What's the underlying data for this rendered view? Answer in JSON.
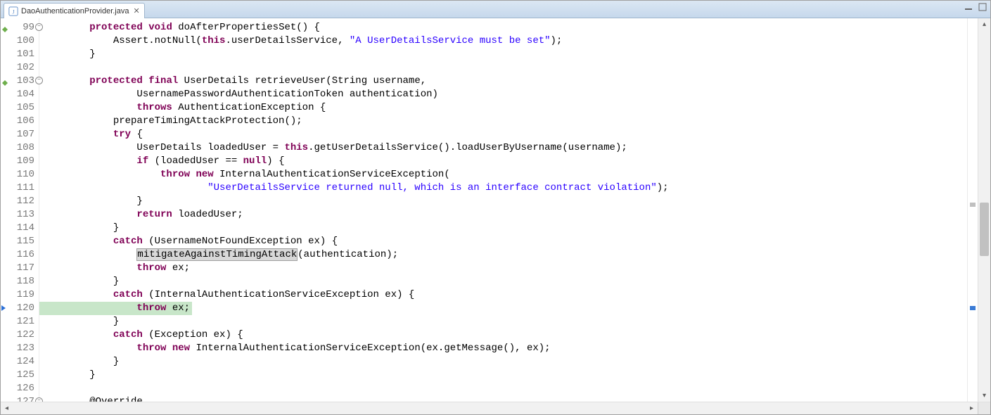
{
  "tab": {
    "filename": "DaoAuthenticationProvider.java",
    "close_glyph": "✕"
  },
  "gutter": {
    "start": 99,
    "end": 127,
    "fold_lines": [
      99,
      103,
      127
    ],
    "instruction_pointer": 120
  },
  "code": {
    "lines": [
      {
        "n": 99,
        "indent": 2,
        "tokens": [
          [
            "kw",
            "protected"
          ],
          [
            "txt",
            " "
          ],
          [
            "kw",
            "void"
          ],
          [
            "txt",
            " doAfterPropertiesSet() {"
          ]
        ]
      },
      {
        "n": 100,
        "indent": 3,
        "tokens": [
          [
            "txt",
            "Assert.notNull("
          ],
          [
            "kw",
            "this"
          ],
          [
            "txt",
            ".userDetailsService, "
          ],
          [
            "str",
            "\"A UserDetailsService must be set\""
          ],
          [
            "txt",
            ");"
          ]
        ]
      },
      {
        "n": 101,
        "indent": 2,
        "tokens": [
          [
            "txt",
            "}"
          ]
        ]
      },
      {
        "n": 102,
        "indent": 0,
        "tokens": []
      },
      {
        "n": 103,
        "indent": 2,
        "tokens": [
          [
            "kw",
            "protected"
          ],
          [
            "txt",
            " "
          ],
          [
            "kw",
            "final"
          ],
          [
            "txt",
            " UserDetails retrieveUser(String username,"
          ]
        ]
      },
      {
        "n": 104,
        "indent": 4,
        "tokens": [
          [
            "txt",
            "UsernamePasswordAuthenticationToken authentication)"
          ]
        ]
      },
      {
        "n": 105,
        "indent": 4,
        "tokens": [
          [
            "kw",
            "throws"
          ],
          [
            "txt",
            " AuthenticationException {"
          ]
        ]
      },
      {
        "n": 106,
        "indent": 3,
        "tokens": [
          [
            "txt",
            "prepareTimingAttackProtection();"
          ]
        ]
      },
      {
        "n": 107,
        "indent": 3,
        "tokens": [
          [
            "kw",
            "try"
          ],
          [
            "txt",
            " {"
          ]
        ]
      },
      {
        "n": 108,
        "indent": 4,
        "tokens": [
          [
            "txt",
            "UserDetails loadedUser = "
          ],
          [
            "kw",
            "this"
          ],
          [
            "txt",
            ".getUserDetailsService().loadUserByUsername(username);"
          ]
        ]
      },
      {
        "n": 109,
        "indent": 4,
        "tokens": [
          [
            "kw",
            "if"
          ],
          [
            "txt",
            " (loadedUser == "
          ],
          [
            "kw",
            "null"
          ],
          [
            "txt",
            ") {"
          ]
        ]
      },
      {
        "n": 110,
        "indent": 5,
        "tokens": [
          [
            "kw",
            "throw"
          ],
          [
            "txt",
            " "
          ],
          [
            "kw",
            "new"
          ],
          [
            "txt",
            " InternalAuthenticationServiceException("
          ]
        ]
      },
      {
        "n": 111,
        "indent": 7,
        "tokens": [
          [
            "str",
            "\"UserDetailsService returned null, which is an interface contract violation\""
          ],
          [
            "txt",
            ");"
          ]
        ]
      },
      {
        "n": 112,
        "indent": 4,
        "tokens": [
          [
            "txt",
            "}"
          ]
        ]
      },
      {
        "n": 113,
        "indent": 4,
        "tokens": [
          [
            "kw",
            "return"
          ],
          [
            "txt",
            " loadedUser;"
          ]
        ]
      },
      {
        "n": 114,
        "indent": 3,
        "tokens": [
          [
            "txt",
            "}"
          ]
        ]
      },
      {
        "n": 115,
        "indent": 3,
        "tokens": [
          [
            "kw",
            "catch"
          ],
          [
            "txt",
            " (UsernameNotFoundException ex) {"
          ]
        ]
      },
      {
        "n": 116,
        "indent": 4,
        "tokens": [
          [
            "hl",
            "mitigateAgainstTimingAttack"
          ],
          [
            "txt",
            "(authentication);"
          ]
        ]
      },
      {
        "n": 117,
        "indent": 4,
        "tokens": [
          [
            "kw",
            "throw"
          ],
          [
            "txt",
            " ex;"
          ]
        ]
      },
      {
        "n": 118,
        "indent": 3,
        "tokens": [
          [
            "txt",
            "}"
          ]
        ]
      },
      {
        "n": 119,
        "indent": 3,
        "tokens": [
          [
            "kw",
            "catch"
          ],
          [
            "txt",
            " (InternalAuthenticationServiceException ex) {"
          ]
        ]
      },
      {
        "n": 120,
        "indent": 4,
        "current": true,
        "tokens": [
          [
            "kw",
            "throw"
          ],
          [
            "txt",
            " ex;"
          ]
        ]
      },
      {
        "n": 121,
        "indent": 3,
        "tokens": [
          [
            "txt",
            "}"
          ]
        ]
      },
      {
        "n": 122,
        "indent": 3,
        "tokens": [
          [
            "kw",
            "catch"
          ],
          [
            "txt",
            " (Exception ex) {"
          ]
        ]
      },
      {
        "n": 123,
        "indent": 4,
        "tokens": [
          [
            "kw",
            "throw"
          ],
          [
            "txt",
            " "
          ],
          [
            "kw",
            "new"
          ],
          [
            "txt",
            " InternalAuthenticationServiceException(ex.getMessage(), ex);"
          ]
        ]
      },
      {
        "n": 124,
        "indent": 3,
        "tokens": [
          [
            "txt",
            "}"
          ]
        ]
      },
      {
        "n": 125,
        "indent": 2,
        "tokens": [
          [
            "txt",
            "}"
          ]
        ]
      },
      {
        "n": 126,
        "indent": 0,
        "tokens": []
      },
      {
        "n": 127,
        "indent": 2,
        "tokens": [
          [
            "txt",
            "@Override"
          ]
        ],
        "clipped": true
      }
    ]
  },
  "overview": {
    "marks": [
      {
        "top_pct": 48,
        "color": "#c0c0c0"
      },
      {
        "top_pct": 75,
        "color": "#3a7bd5"
      }
    ]
  },
  "vscroll": {
    "thumb_top_pct": 48,
    "thumb_height_pct": 14
  }
}
